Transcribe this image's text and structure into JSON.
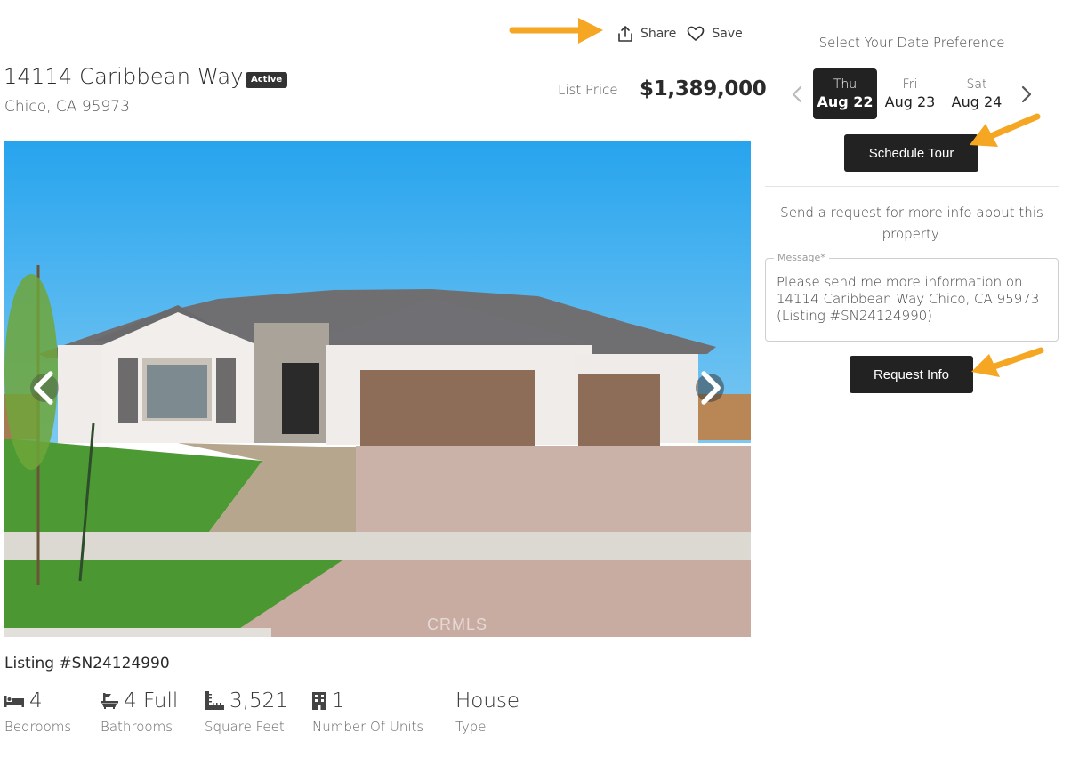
{
  "actions": {
    "share_label": "Share",
    "save_label": "Save",
    "share_icon": "share-upload-icon",
    "save_icon": "heart-outline-icon"
  },
  "property": {
    "street": "14114 Caribbean Way",
    "status": "Active",
    "city_state_zip": "Chico, CA 95973",
    "price_label": "List Price",
    "price": "$1,389,000",
    "listing_id": "Listing #SN24124990",
    "photo_watermark": "CRMLS"
  },
  "facts": [
    {
      "icon": "bed-icon",
      "value": "4",
      "label": "Bedrooms"
    },
    {
      "icon": "bathtub-icon",
      "value": "4 Full",
      "label": "Bathrooms"
    },
    {
      "icon": "ruler-square-icon",
      "value": "3,521",
      "label": "Square Feet"
    },
    {
      "icon": "building-icon",
      "value": "1",
      "label": "Number Of Units"
    },
    {
      "icon": "",
      "value": "House",
      "label": "Type"
    }
  ],
  "tour": {
    "heading": "Select Your Date Preference",
    "dates": [
      {
        "dow": "Thu",
        "day": "Aug 22",
        "selected": true
      },
      {
        "dow": "Fri",
        "day": "Aug 23",
        "selected": false
      },
      {
        "dow": "Sat",
        "day": "Aug 24",
        "selected": false
      }
    ],
    "schedule_label": "Schedule Tour"
  },
  "info_request": {
    "prompt": "Send a request for more info about this property.",
    "message_label": "Message*",
    "message_value": "Please send me more information on 14114 Caribbean Way Chico, CA 95973 (Listing #SN24124990)",
    "button_label": "Request Info"
  },
  "colors": {
    "dark": "#222222",
    "annotation_arrow": "#F5A623"
  }
}
